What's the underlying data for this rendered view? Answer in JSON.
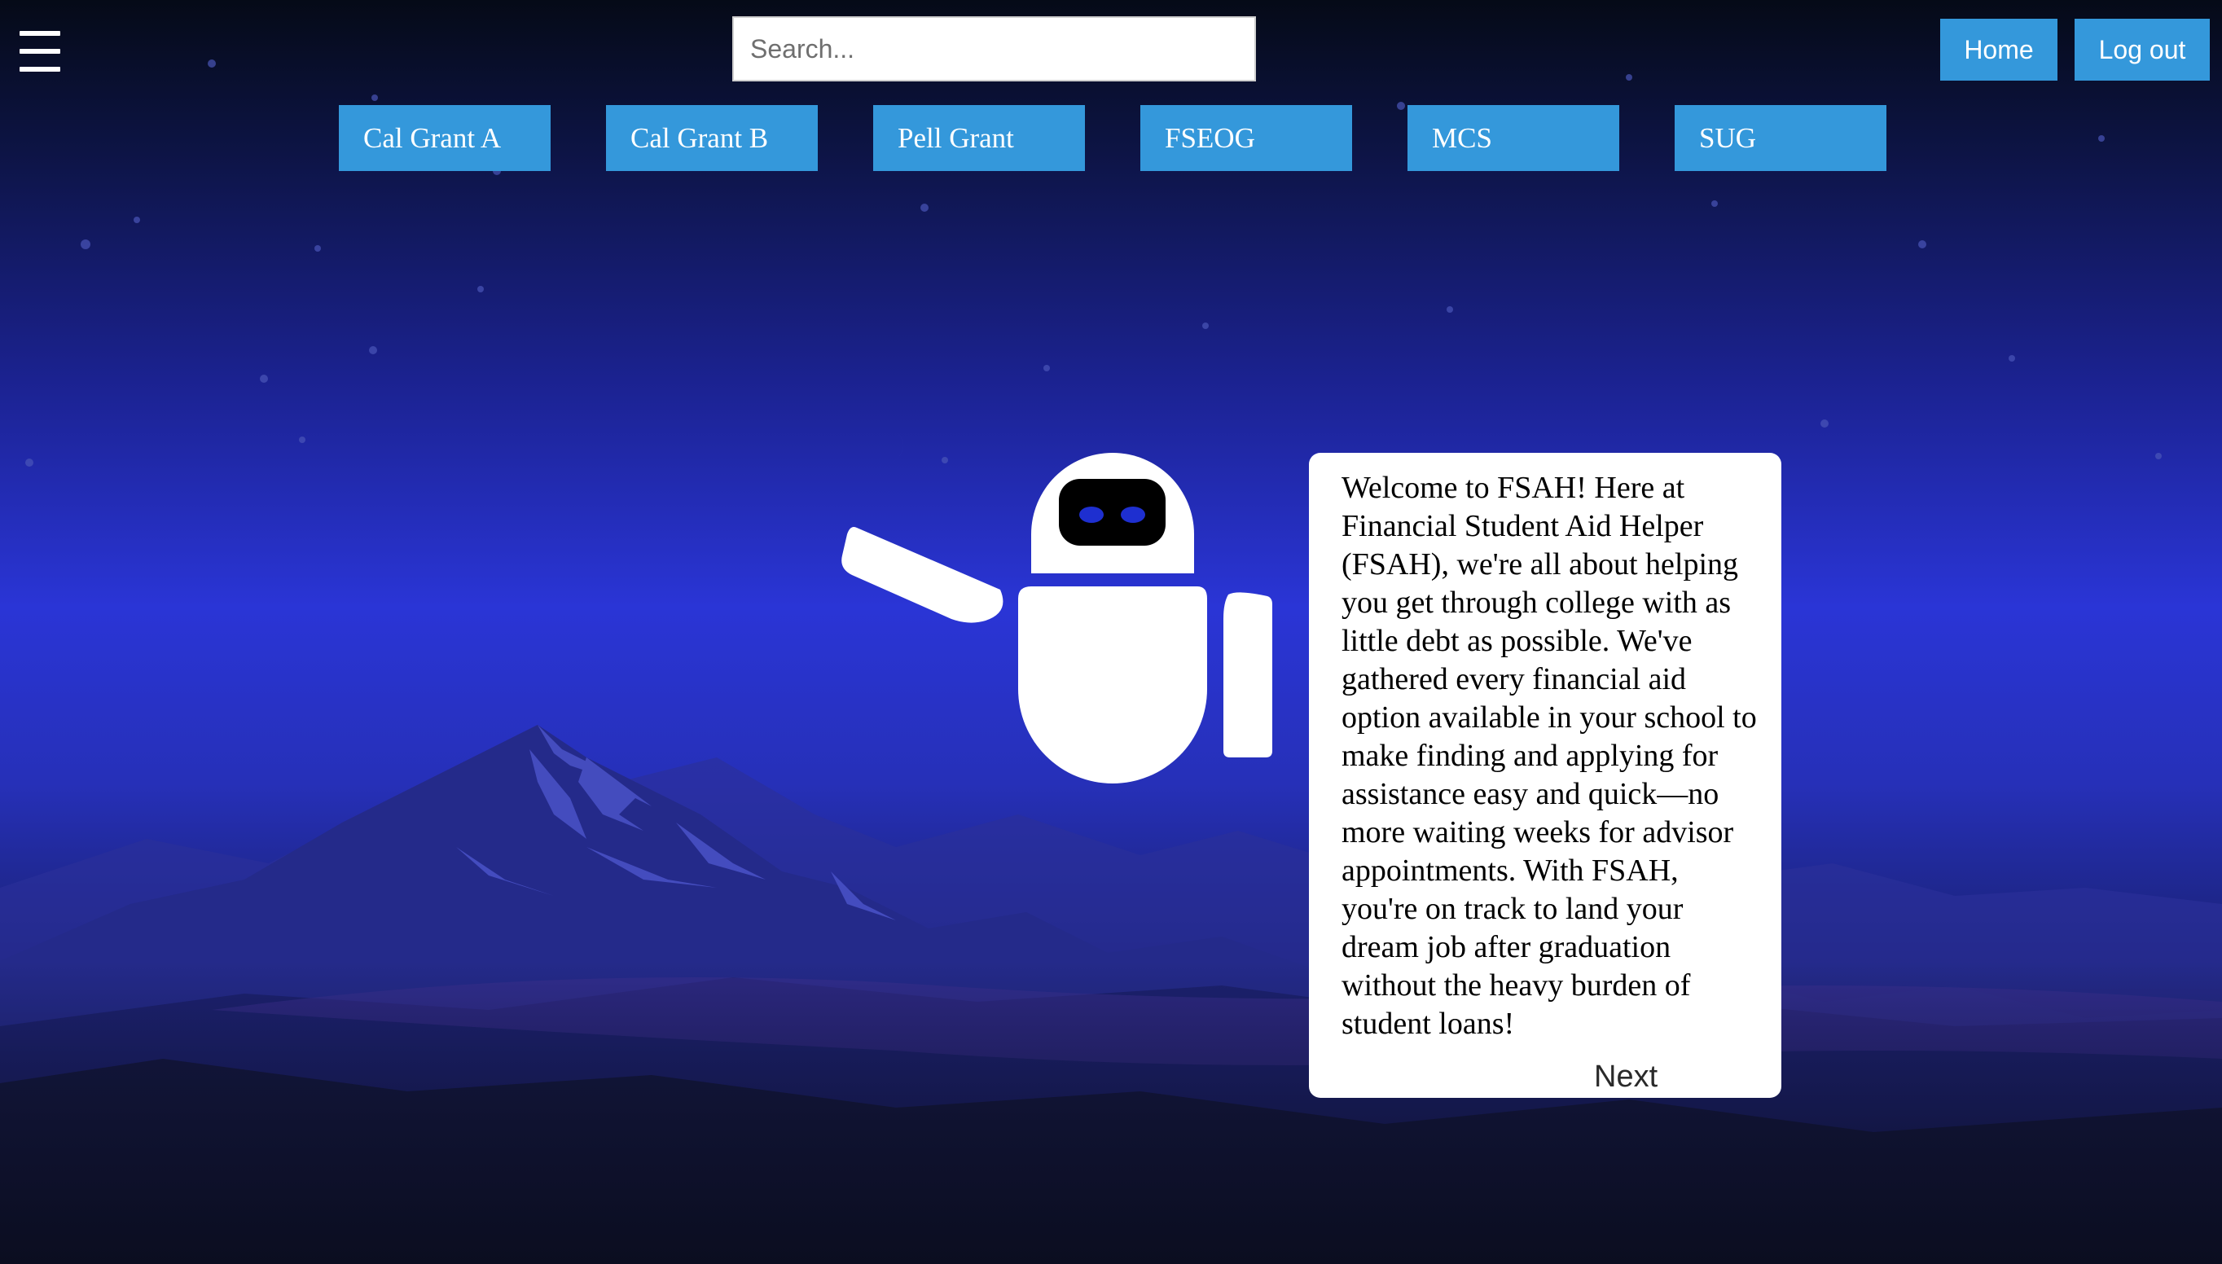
{
  "search": {
    "placeholder": "Search...",
    "value": ""
  },
  "header": {
    "home_label": "Home",
    "logout_label": "Log out"
  },
  "grants": [
    {
      "label": "Cal Grant A"
    },
    {
      "label": "Cal Grant B"
    },
    {
      "label": "Pell Grant"
    },
    {
      "label": "FSEOG"
    },
    {
      "label": "MCS"
    },
    {
      "label": "SUG"
    }
  ],
  "card": {
    "text": "Welcome to FSAH! Here at Financial Student Aid Helper (FSAH), we're all about helping you get through college with as little debt as possible. We've gathered every financial aid option available in your school to make finding and applying for assistance easy and quick—no more waiting weeks for advisor appointments. With FSAH, you're on track to land your dream job after graduation without the heavy burden of student loans!",
    "next_label": "Next"
  },
  "icons": {
    "menu": "hamburger-menu-icon",
    "mascot": "robot-mascot"
  },
  "colors": {
    "button": "#3498db",
    "sky_top": "#050a17",
    "sky_mid": "#2a35d6",
    "robot": "#ffffff",
    "robot_visor": "#000000",
    "robot_eyes": "#1e2fd0"
  }
}
